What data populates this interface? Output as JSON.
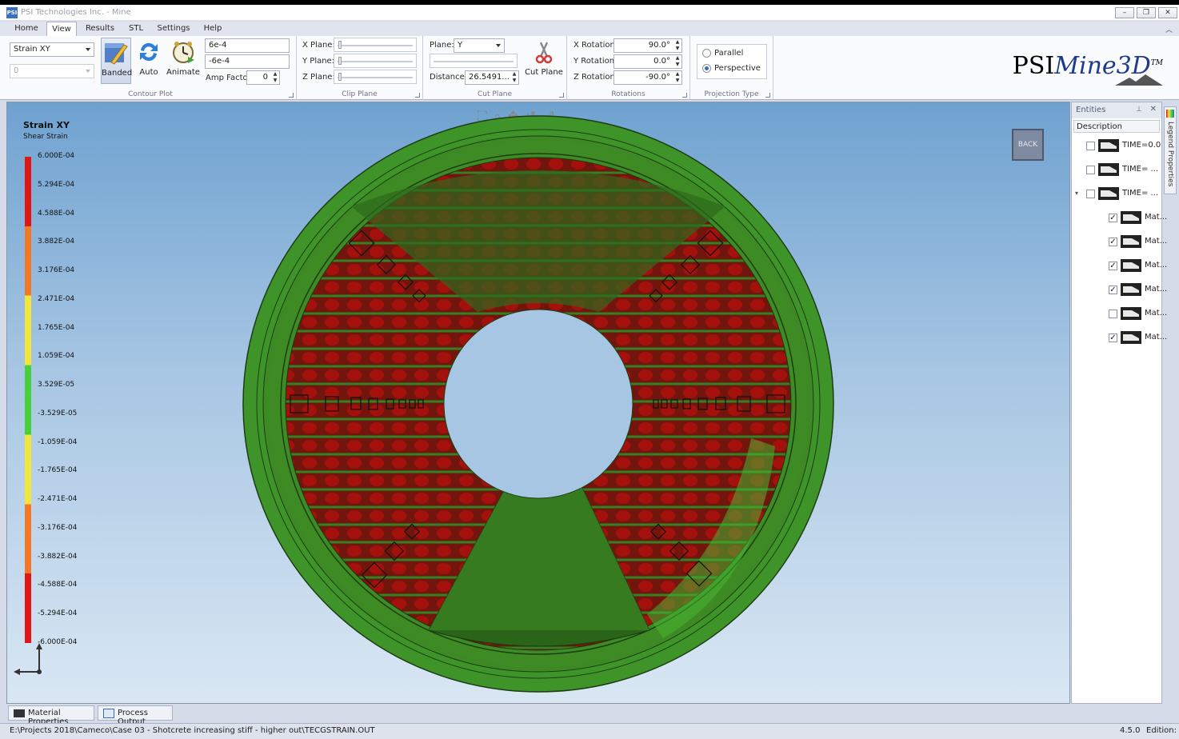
{
  "window": {
    "app_icon": "PSI",
    "title": "PSI Technologies Inc. - Mine",
    "controls": [
      "–",
      "❐",
      "✕"
    ]
  },
  "menu": {
    "tabs": [
      "Home",
      "View",
      "Results",
      "STL",
      "Settings",
      "Help"
    ],
    "active": "View"
  },
  "ribbon": {
    "contour_plot": {
      "label": "Contour Plot",
      "variable": "Strain XY",
      "secondary": "0",
      "buttons": [
        "Banded",
        "Auto",
        "Animate"
      ],
      "max_value": "6e-4",
      "min_value": "-6e-4",
      "amp_factor_label": "Amp Factor",
      "amp_factor": "0"
    },
    "clip_plane": {
      "label": "Clip Plane",
      "x_label": "X Plane:",
      "y_label": "Y Plane:",
      "z_label": "Z Plane:"
    },
    "cut_plane": {
      "label": "Cut Plane",
      "plane_label": "Plane:",
      "plane_value": "Y",
      "distance_label": "Distance:",
      "distance_value": "26.5491...",
      "button": "Cut Plane"
    },
    "rotations": {
      "label": "Rotations",
      "x_label": "X Rotation:",
      "x_value": "90.0°",
      "y_label": "Y Rotation:",
      "y_value": "0.0°",
      "z_label": "Z Rotation:",
      "z_value": "-90.0°"
    },
    "projection": {
      "label": "Projection Type",
      "parallel": "Parallel",
      "perspective": "Perspective",
      "selected": "Perspective"
    }
  },
  "logo": {
    "text_plain": "PSI",
    "text_italic": "Mine3D",
    "tm": "TM"
  },
  "viewport": {
    "legend_title": "Strain XY",
    "legend_subtitle": "Shear Strain",
    "legend_values": [
      "6.000E-04",
      "5.294E-04",
      "4.588E-04",
      "3.882E-04",
      "3.176E-04",
      "2.471E-04",
      "1.765E-04",
      "1.059E-04",
      "3.529E-05",
      "-3.529E-05",
      "-1.059E-04",
      "-1.765E-04",
      "-2.471E-04",
      "-3.176E-04",
      "-3.882E-04",
      "-4.588E-04",
      "-5.294E-04",
      "-6.000E-04"
    ],
    "legend_colors": [
      "#e01515",
      "#f07828",
      "#f0e63c",
      "#46d13c",
      "#f0e63c",
      "#f07828",
      "#e01515"
    ],
    "nav_icons": [
      "zoom-window-icon",
      "zoom-icon",
      "pan-icon",
      "rotate-icon",
      "fit-icon"
    ],
    "view_cube": "BACK"
  },
  "entities": {
    "header": "Entities",
    "column": "Description",
    "rows": [
      {
        "label": "TIME=0.0",
        "checked": false,
        "indent": 0
      },
      {
        "label": "TIME= ...",
        "checked": false,
        "indent": 0
      },
      {
        "label": "TIME= ...",
        "checked": false,
        "indent": 0,
        "expanded": true
      },
      {
        "label": "Mat...",
        "checked": true,
        "indent": 1
      },
      {
        "label": "Mat...",
        "checked": true,
        "indent": 1
      },
      {
        "label": "Mat...",
        "checked": true,
        "indent": 1
      },
      {
        "label": "Mat...",
        "checked": true,
        "indent": 1
      },
      {
        "label": "Mat...",
        "checked": false,
        "indent": 1
      },
      {
        "label": "Mat...",
        "checked": true,
        "indent": 1
      }
    ]
  },
  "side_tab": "Legend Properties",
  "bottom_tabs": [
    "Material Properties",
    "Process Output"
  ],
  "status": {
    "path": "E:\\Projects 2018\\Cameco\\Case 03 - Shotcrete increasing stiff - higher out\\TECGSTRAIN.OUT",
    "version": "4.5.0",
    "edition_label": "Edition:"
  }
}
